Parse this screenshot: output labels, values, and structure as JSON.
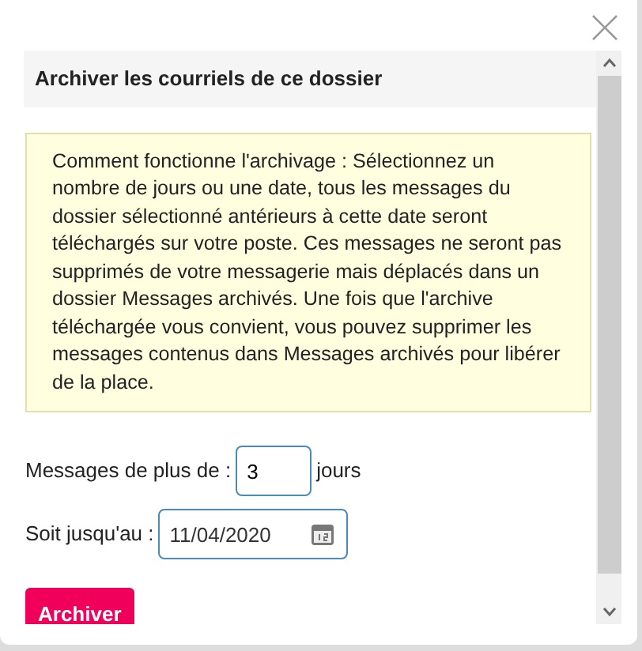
{
  "dialog": {
    "title": "Archiver les courriels de ce dossier",
    "info": "Comment fonctionne l'archivage : Sélectionnez un nombre de jours ou une date, tous les messages du dossier sélectionné antérieurs à cette date seront téléchargés sur votre poste. Ces messages ne seront pas supprimés de votre messagerie mais déplacés dans un dossier Messages archivés. Une fois que l'archive téléchargée vous convient, vous pouvez supprimer les messages contenus dans Messages archivés pour libérer de la place.",
    "days": {
      "label": "Messages de plus de :",
      "value": "3",
      "unit": "jours"
    },
    "date": {
      "label": "Soit jusqu'au :",
      "value": "11/04/2020"
    },
    "button": "Archiver"
  }
}
